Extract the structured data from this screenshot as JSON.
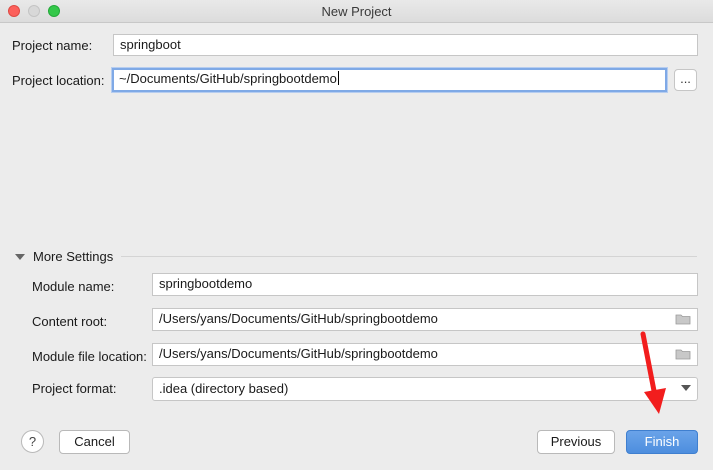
{
  "window": {
    "title": "New Project"
  },
  "project": {
    "name_label": "Project name:",
    "name_value": "springboot",
    "location_label": "Project location:",
    "location_value": "~/Documents/GitHub/springbootdemo",
    "browse_label": "..."
  },
  "more_settings": {
    "header": "More Settings",
    "module_name_label": "Module name:",
    "module_name_value": "springbootdemo",
    "content_root_label": "Content root:",
    "content_root_value": "/Users/yans/Documents/GitHub/springbootdemo",
    "module_file_label": "Module file location:",
    "module_file_value": "/Users/yans/Documents/GitHub/springbootdemo",
    "format_label": "Project format:",
    "format_value": ".idea (directory based)"
  },
  "footer": {
    "help_label": "?",
    "cancel_label": "Cancel",
    "previous_label": "Previous",
    "finish_label": "Finish"
  },
  "colors": {
    "accent": "#4d8ede",
    "annotation_arrow": "#f21d1d",
    "close": "#fc605b",
    "maximize": "#34c84a"
  },
  "icons": {
    "collapse": "triangle-down-icon",
    "folder": "folder-icon",
    "dropdown": "chevron-down-icon",
    "annotation": "red-arrow-icon"
  }
}
